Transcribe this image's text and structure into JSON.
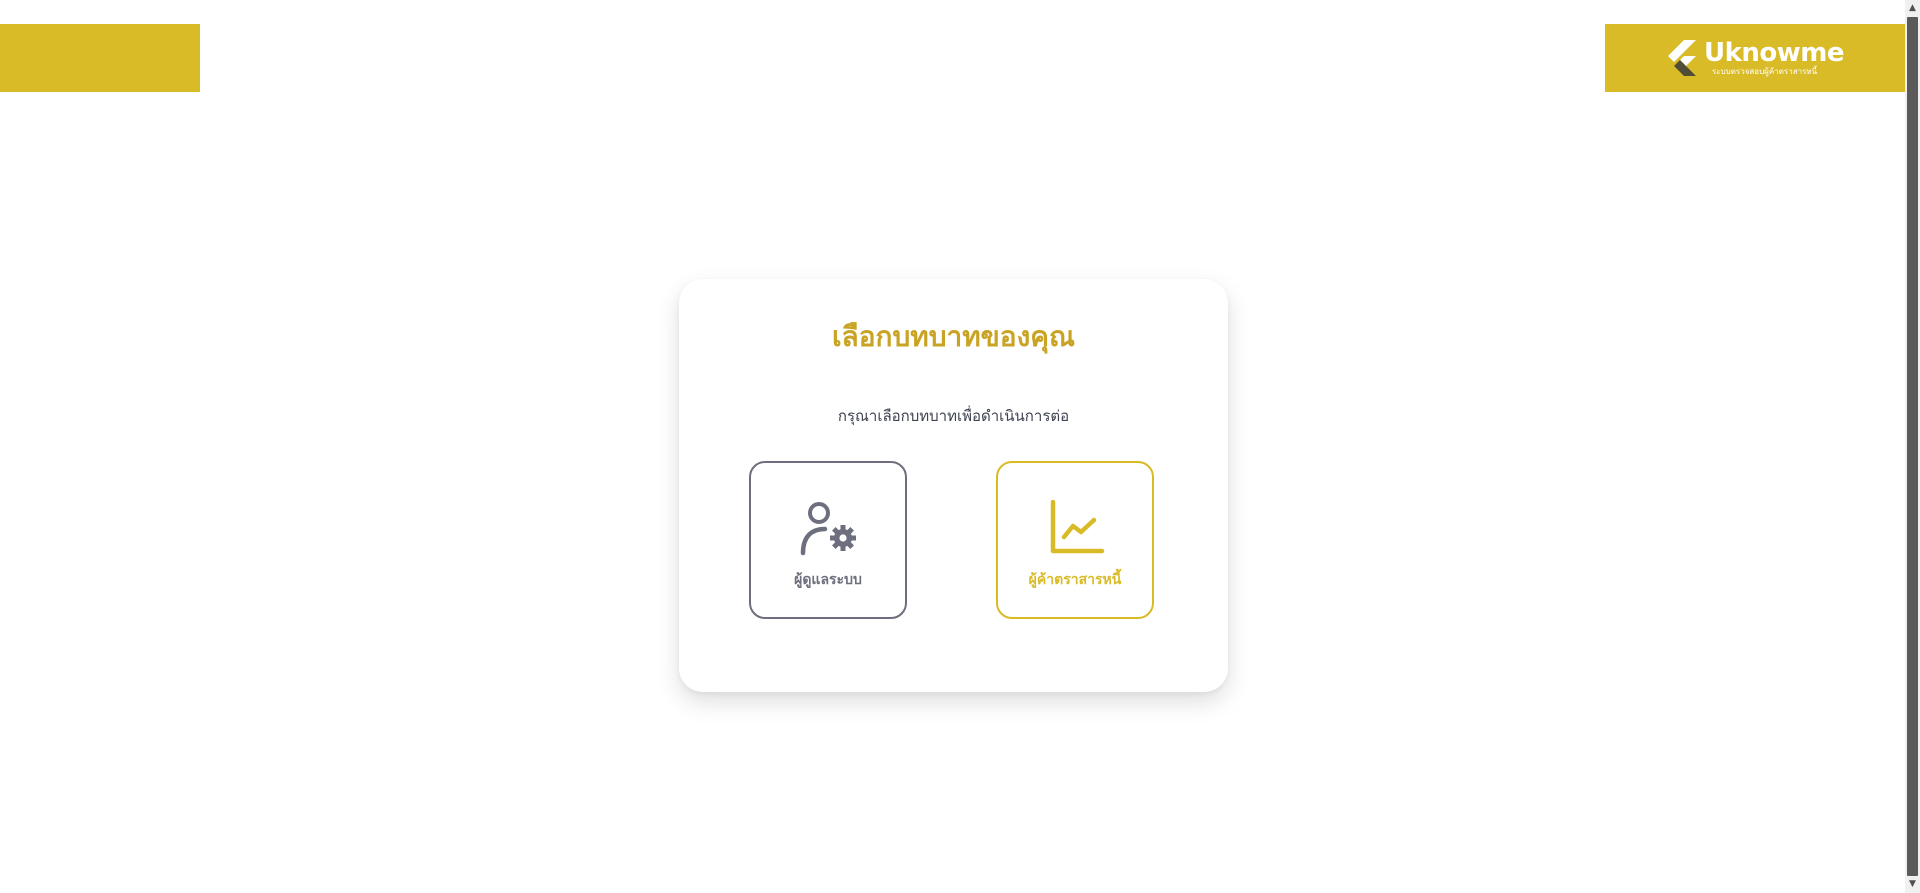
{
  "header": {
    "logo": {
      "word": "Uknowme",
      "tagline": "ระบบตรวจสอบผู้ค้าตราสารหนี้"
    }
  },
  "card": {
    "title": "เลือกบทบาทของคุณ",
    "subtitle": "กรุณาเลือกบทบาทเพื่อดำเนินการต่อ",
    "roles": [
      {
        "label": "ผู้ดูแลระบบ",
        "icon": "user-gear-icon"
      },
      {
        "label": "ผู้ค้าตราสารหนี้",
        "icon": "line-chart-icon"
      }
    ]
  },
  "colors": {
    "brand_yellow": "#d9bb28",
    "title_gold": "#c9a424",
    "admin_gray": "#6e6f7e",
    "text_dark": "#3e4250"
  }
}
